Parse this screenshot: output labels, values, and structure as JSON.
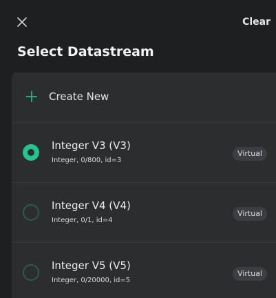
{
  "header": {
    "clear_label": "Clear",
    "title": "Select Datastream"
  },
  "create": {
    "label": "Create New"
  },
  "datastreams": [
    {
      "name": "Integer V3 (V3)",
      "meta": "Integer, 0/800, id=3",
      "badge": "Virtual",
      "selected": true
    },
    {
      "name": "Integer V4 (V4)",
      "meta": "Integer, 0/1, id=4",
      "badge": "Virtual",
      "selected": false
    },
    {
      "name": "Integer V5 (V5)",
      "meta": "Integer, 0/20000, id=5",
      "badge": "Virtual",
      "selected": false
    }
  ],
  "colors": {
    "background": "#1d1f21",
    "panel": "#2b2d2f",
    "accent": "#23c48e"
  },
  "icons": {
    "close": "close-icon",
    "add": "plus-icon"
  }
}
